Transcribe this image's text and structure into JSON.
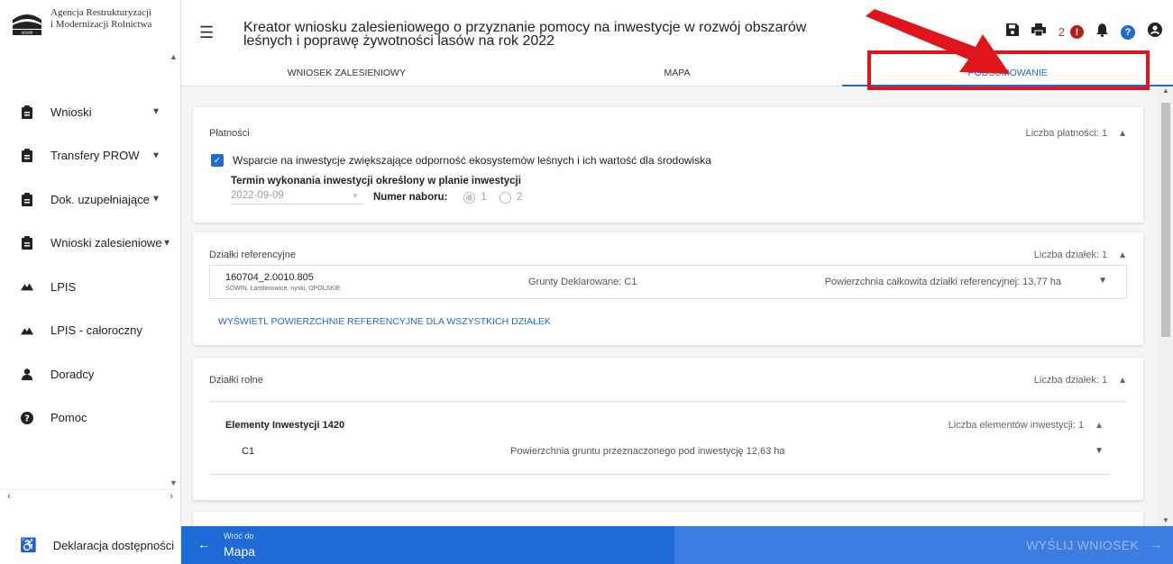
{
  "sidebar": {
    "logo_line1": "Agencja Restrukturyzacji",
    "logo_line2": "i Modernizacji Rolnictwa",
    "items": [
      {
        "label": "Wnioski",
        "chevron": "⌄"
      },
      {
        "label": "Transfery PROW",
        "chevron": "⌄"
      },
      {
        "label": "Dok. uzupełniające",
        "chevron": "⌄"
      },
      {
        "label": "Wnioski zalesieniowe",
        "chevron": "⌄"
      },
      {
        "label": "LPIS"
      },
      {
        "label": "LPIS - całoroczny"
      },
      {
        "label": "Doradcy"
      },
      {
        "label": "Pomoc"
      }
    ],
    "accessibility": "Deklaracja dostępności"
  },
  "header": {
    "title": "Kreator wniosku zalesieniowego o przyznanie pomocy na inwestycje w rozwój obszarów leśnych i poprawę żywotności lasów na rok 2022",
    "error_count": "2",
    "tabs": [
      {
        "label": "WNIOSEK ZALESIENIOWY"
      },
      {
        "label": "MAPA"
      },
      {
        "label": "PODSUMOWANIE"
      }
    ]
  },
  "payments": {
    "heading": "Płatności",
    "count": "Liczba płatności: 1",
    "support_label": "Wsparcie na inwestycje zwiększające odporność ekosystemów leśnych i ich wartość dla środowiska",
    "term_label": "Termin wykonania inwestycji określony w planie inwestycji",
    "date_value": "2022-09-09",
    "nabor_label": "Numer naboru:",
    "nabor_options": [
      "1",
      "2"
    ]
  },
  "reference": {
    "heading": "Działki referencyjne",
    "count": "Liczba działek: 1",
    "parcel_id": "160704_2.0010.805",
    "parcel_location": "SOWIN, Łambinowice, nyski, OPOLSKIE",
    "parcel_grounds": "Grunty Deklarowane: C1",
    "parcel_area": "Powierzchnia całkowita działki referencyjnej: 13,77 ha",
    "link": "WYŚWIETL POWIERZCHNIE REFERENCYJNE DLA WSZYSTKICH DZIAŁEK"
  },
  "agricultural": {
    "heading": "Działki rolne",
    "count": "Liczba działek: 1",
    "elements_heading": "Elementy Inwestycji 1420",
    "elements_count": "Liczba elementów inwestycji: 1",
    "element_code": "C1",
    "element_area": "Powierzchnia gruntu przeznaczonego pod inwestycję 12,63 ha"
  },
  "footer": {
    "back_small": "Wróć do",
    "back_big": "Mapa",
    "send": "WYŚLIJ WNIOSEK"
  },
  "colors": {
    "accent": "#1e6ad6",
    "annotation": "#e0151b",
    "error": "#b71c1c"
  }
}
